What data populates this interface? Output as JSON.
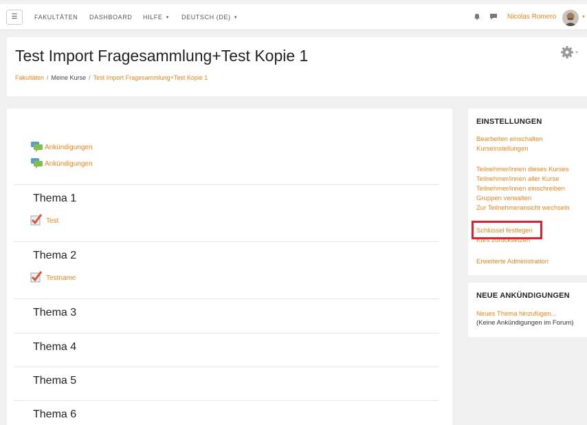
{
  "navbar": {
    "menu_toggle": "☰",
    "items": [
      {
        "label": "FAKULTÄTEN"
      },
      {
        "label": "DASHBOARD"
      },
      {
        "label": "HILFE"
      },
      {
        "label": "DEUTSCH (DE)"
      }
    ],
    "user_name": "Nicolas Romero",
    "icons": [
      "bell-icon",
      "chat-icon",
      "avatar"
    ]
  },
  "header": {
    "title": "Test Import Fragesammlung+Test Kopie 1",
    "breadcrumb": [
      "Fakultäten",
      "Meine Kurse",
      "Test Import Fragesammlung+Test Kopie 1"
    ]
  },
  "main": {
    "forums": [
      "Ankündigungen",
      "Ankündigungen"
    ],
    "sections": [
      {
        "title": "Thema 1",
        "activities": [
          "Test"
        ]
      },
      {
        "title": "Thema 2",
        "activities": [
          "Testname"
        ]
      },
      {
        "title": "Thema 3",
        "activities": []
      },
      {
        "title": "Thema 4",
        "activities": []
      },
      {
        "title": "Thema 5",
        "activities": []
      },
      {
        "title": "Thema 6",
        "activities": []
      }
    ]
  },
  "settings_block": {
    "title": "EINSTELLUNGEN",
    "group1": [
      "Bearbeiten einschalten",
      "Kurseinstellungen"
    ],
    "group2": [
      "Teilnehmer/innen dieses Kurses",
      "Teilnehmer/innen aller Kurse",
      "Teilnehmer/innen einschreiben",
      "Gruppen verwalten",
      "Zur Teilnehmeransicht wechseln"
    ],
    "group3": [
      "Schlüssel festlegen",
      "Kurs zurücksetzen"
    ],
    "group4": [
      "Erweiterte Administration"
    ]
  },
  "news_block": {
    "title": "NEUE ANKÜNDIGUNGEN",
    "add_link": "Neues Thema hinzufügen...",
    "empty_text": "(Keine Ankündigungen im Forum)"
  },
  "colors": {
    "accent": "#f98012",
    "highlight": "#e0202a",
    "page_bg": "#f0f0f0"
  }
}
